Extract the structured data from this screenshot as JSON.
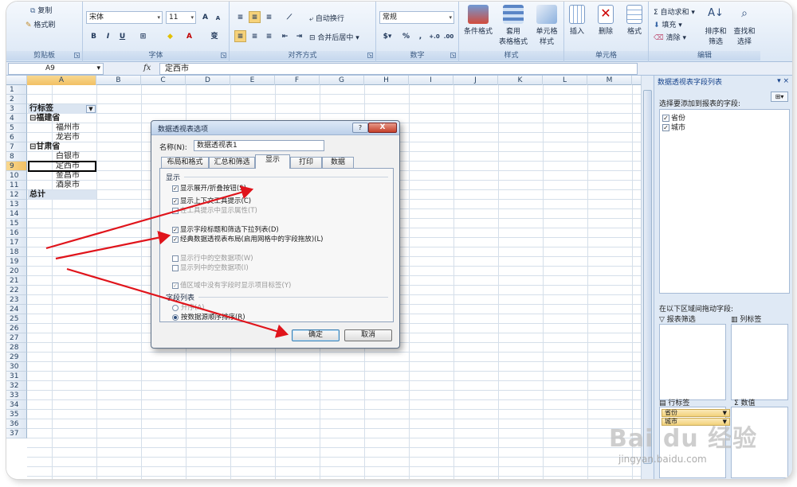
{
  "ribbon": {
    "clipboard": {
      "copy": "复制",
      "format_painter": "格式刷",
      "label": "剪贴板"
    },
    "font": {
      "name": "宋体",
      "size": "11",
      "grow": "A",
      "shrink": "A",
      "bold": "B",
      "italic": "I",
      "underline": "U",
      "border": "⊞",
      "fill": "◆",
      "color": "A",
      "phonetic": "变",
      "label": "字体"
    },
    "alignment": {
      "wrap": "自动换行",
      "merge": "合并后居中",
      "label": "对齐方式"
    },
    "number": {
      "format": "常规",
      "percent": "%",
      "comma": ",",
      "inc": "+.0",
      "dec": ".00",
      "label": "数字"
    },
    "styles": {
      "conditional": "条件格式",
      "table_format_1": "套用",
      "table_format_2": "表格格式",
      "cell_styles_1": "单元格",
      "cell_styles_2": "样式",
      "label": "样式"
    },
    "cells": {
      "insert": "插入",
      "delete": "删除",
      "format": "格式",
      "label": "单元格"
    },
    "editing": {
      "autosum": "Σ 自动求和",
      "fill": "填充",
      "clear": "清除",
      "sort_1": "排序和",
      "sort_2": "筛选",
      "find_1": "查找和",
      "find_2": "选择",
      "label": "编辑"
    }
  },
  "formula_bar": {
    "cell_ref": "A9",
    "fx": "fx",
    "value": "定西市"
  },
  "columns": [
    "A",
    "B",
    "C",
    "D",
    "E",
    "F",
    "G",
    "H",
    "I",
    "J",
    "K",
    "L",
    "M"
  ],
  "rows": [
    "1",
    "2",
    "3",
    "4",
    "5",
    "6",
    "7",
    "8",
    "9",
    "10",
    "11",
    "12",
    "13",
    "14",
    "15",
    "16",
    "17",
    "18",
    "19",
    "20",
    "21",
    "22",
    "23",
    "24",
    "25",
    "26",
    "27",
    "28",
    "29",
    "30",
    "31",
    "32",
    "33",
    "34",
    "35",
    "36",
    "37"
  ],
  "pivot": {
    "row_label": "行标签",
    "filter_symbol": "▼",
    "items": [
      {
        "row": 4,
        "text": "⊟福建省",
        "level": 0,
        "bold": true
      },
      {
        "row": 5,
        "text": "福州市",
        "level": 1,
        "bold": false
      },
      {
        "row": 6,
        "text": "龙岩市",
        "level": 1,
        "bold": false
      },
      {
        "row": 7,
        "text": "⊟甘肃省",
        "level": 0,
        "bold": true
      },
      {
        "row": 8,
        "text": "白银市",
        "level": 1,
        "bold": false
      },
      {
        "row": 9,
        "text": "定西市",
        "level": 1,
        "bold": false
      },
      {
        "row": 10,
        "text": "金昌市",
        "level": 1,
        "bold": false
      },
      {
        "row": 11,
        "text": "酒泉市",
        "level": 1,
        "bold": false
      }
    ],
    "total": "总计"
  },
  "field_pane": {
    "title": "数据透视表字段列表",
    "close": "▾ ×",
    "choose": "选择要添加到报表的字段:",
    "fields": [
      {
        "label": "省份",
        "checked": "✓"
      },
      {
        "label": "城市",
        "checked": "✓"
      }
    ],
    "drag": "在以下区域间拖动字段:",
    "report_filter": "报表筛选",
    "column_labels": "列标签",
    "row_labels": "行标签",
    "values": "Σ 数值",
    "row_chips": [
      "省份",
      "城市"
    ]
  },
  "dialog": {
    "title": "数据透视表选项",
    "help": "?",
    "close": "X",
    "name_label": "名称(N):",
    "name_value": "数据透视表1",
    "tabs": [
      "布局和格式",
      "汇总和筛选",
      "显示",
      "打印",
      "数据"
    ],
    "display_section": "显示",
    "options": [
      {
        "label": "显示展开/折叠按钮(S)",
        "checked": "✓",
        "disabled": false
      },
      {
        "label": "显示上下文工具提示(C)",
        "checked": "✓",
        "disabled": false
      },
      {
        "label": "在工具提示中显示属性(T)",
        "checked": "",
        "disabled": true
      },
      {
        "label": "显示字段标题和筛选下拉列表(D)",
        "checked": "✓",
        "disabled": false
      },
      {
        "label": "经典数据透视表布局(启用网格中的字段拖放)(L)",
        "checked": "✓",
        "disabled": false
      },
      {
        "label": "显示行中的空数据项(W)",
        "checked": "",
        "disabled": true
      },
      {
        "label": "显示列中的空数据项(I)",
        "checked": "",
        "disabled": true
      },
      {
        "label": "值区域中没有字段时显示项目标签(Y)",
        "checked": "✓",
        "disabled": true
      }
    ],
    "field_list_section": "字段列表",
    "sort_asc": "升序(A)",
    "sort_source": "按数据源顺序排序(R)",
    "ok": "确定",
    "cancel": "取消"
  },
  "watermark": {
    "text": "Bai du 经验",
    "sub": "jingyan.baidu.com"
  },
  "colors": {
    "arrow": "#e0141b",
    "accent": "#15428b",
    "selection": "#f2c064"
  }
}
